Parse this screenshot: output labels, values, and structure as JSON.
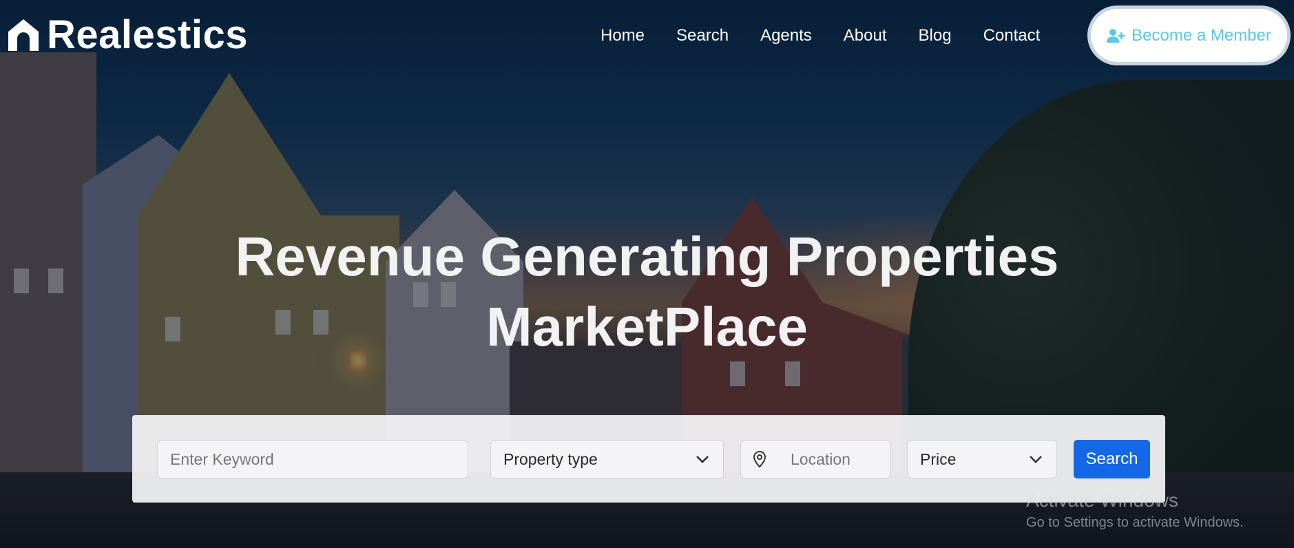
{
  "brand": {
    "name": "Realestics",
    "icon": "house-icon"
  },
  "nav": {
    "items": [
      {
        "label": "Home"
      },
      {
        "label": "Search"
      },
      {
        "label": "Agents"
      },
      {
        "label": "About"
      },
      {
        "label": "Blog"
      },
      {
        "label": "Contact"
      }
    ],
    "member_button": {
      "label": "Become a Member",
      "icon": "user-plus-icon"
    }
  },
  "hero": {
    "title_line1": "Revenue Generating Properties",
    "title_line2": "MarketPlace"
  },
  "search": {
    "keyword_placeholder": "Enter Keyword",
    "property_type": "Property type",
    "location_placeholder": "Location",
    "price": "Price",
    "button_label": "Search"
  },
  "watermark": {
    "title": "Activate Windows",
    "subtitle": "Go to Settings to activate Windows."
  },
  "colors": {
    "accent": "#1468e8",
    "member_text": "#5bc8e8"
  }
}
